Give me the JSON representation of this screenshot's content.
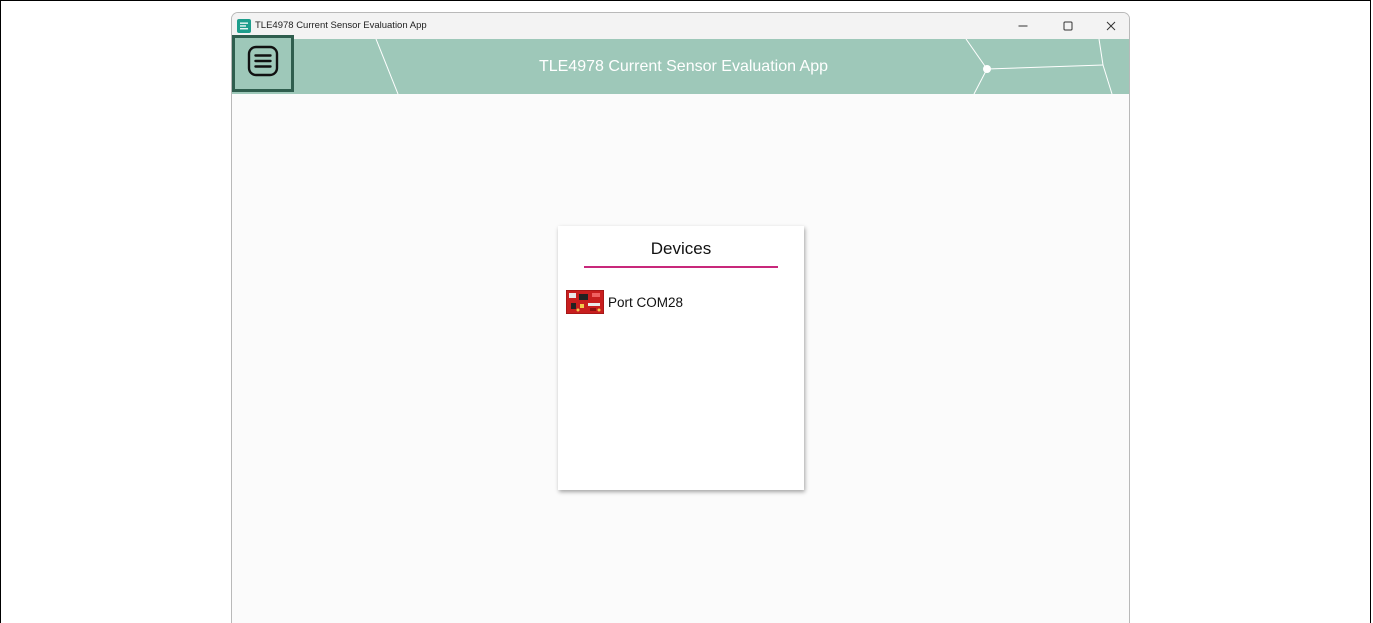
{
  "window": {
    "title": "TLE4978 Current Sensor Evaluation App",
    "controls": {
      "minimize_icon": "minimize-icon",
      "maximize_icon": "maximize-icon",
      "close_icon": "close-icon"
    }
  },
  "header": {
    "title": "TLE4978 Current Sensor Evaluation App",
    "menu_icon": "hamburger-menu-icon",
    "background_color": "#9ec8b9",
    "menu_border_color": "#2f5e4e"
  },
  "devices": {
    "title": "Devices",
    "underline_color": "#c8287b",
    "items": [
      {
        "label": "Port COM28",
        "icon": "board-thumbnail-icon"
      }
    ]
  }
}
